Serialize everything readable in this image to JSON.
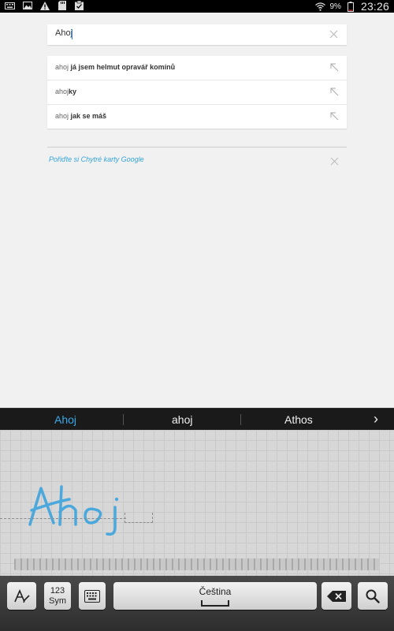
{
  "status_bar": {
    "battery_percent": "9%",
    "time": "23:26",
    "icons": [
      "keyboard-icon",
      "image-icon",
      "warning-icon",
      "sd-card-icon",
      "clipboard-check-icon",
      "wifi-icon",
      "battery-icon"
    ]
  },
  "search": {
    "value": "Ahoj",
    "clear_icon": "close-icon"
  },
  "suggestions": [
    {
      "prefix": "ahoj ",
      "completion": "já jsem helmut opravář komínů",
      "icon": "arrow-up-left-icon"
    },
    {
      "prefix": "ahoj",
      "completion": "ky",
      "icon": "arrow-up-left-icon"
    },
    {
      "prefix": "ahoj ",
      "completion": "jak se máš",
      "icon": "arrow-up-left-icon"
    }
  ],
  "promo": {
    "text": "Pořiďte si Chytré karty Google",
    "close_icon": "close-icon"
  },
  "candidates": {
    "items": [
      "Ahoj",
      "ahoj",
      "Athos"
    ],
    "active_index": 0,
    "next_icon": "chevron-right-icon"
  },
  "handwriting": {
    "ink_text": "Ahoj",
    "ink_color": "#4aa8dc"
  },
  "keyboard": {
    "mode_icon": "handwriting-mode-icon",
    "sym_label_top": "123",
    "sym_label_bottom": "Sym",
    "keyboard_icon": "keyboard-icon",
    "space_label": "Čeština",
    "backspace_icon": "backspace-icon",
    "search_icon": "search-icon"
  },
  "colors": {
    "accent": "#3aa7e6",
    "link": "#33a3d6"
  }
}
